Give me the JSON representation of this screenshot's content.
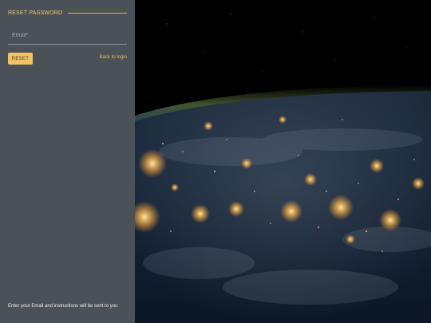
{
  "form": {
    "title": "RESET PASSWORD",
    "email_placeholder": "Email*",
    "reset_label": "RESET",
    "back_label": "Back to login",
    "hint": "Enter your Email and instructions will be sent to you"
  },
  "colors": {
    "panel": "#4a5157",
    "accent": "#f3c262",
    "space": "#000000",
    "city_lights": "#ffc46b"
  },
  "background_image": "earth-at-night-from-orbit"
}
